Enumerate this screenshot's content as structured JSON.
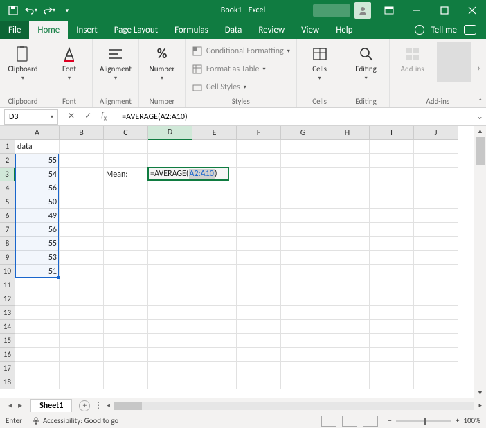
{
  "title": "Book1 - Excel",
  "tabs": {
    "file": "File",
    "home": "Home",
    "insert": "Insert",
    "pageLayout": "Page Layout",
    "formulas": "Formulas",
    "data": "Data",
    "review": "Review",
    "view": "View",
    "help": "Help",
    "tellMe": "Tell me"
  },
  "ribbon": {
    "clipboard": "Clipboard",
    "font": "Font",
    "alignment": "Alignment",
    "number": "Number",
    "styles": "Styles",
    "cells": "Cells",
    "editing": "Editing",
    "addins": "Add-ins",
    "condFmt": "Conditional Formatting",
    "fmtTable": "Format as Table",
    "cellStyles": "Cell Styles"
  },
  "nameBox": "D3",
  "formula": "=AVERAGE(A2:A10)",
  "columns": [
    "A",
    "B",
    "C",
    "D",
    "E",
    "F",
    "G",
    "H",
    "I",
    "J"
  ],
  "activeCol": "D",
  "activeRow": 3,
  "rowCount": 18,
  "cells": {
    "A1": "data",
    "A2": "55",
    "A3": "54",
    "A4": "56",
    "A5": "50",
    "A6": "49",
    "A7": "56",
    "A8": "55",
    "A9": "53",
    "A10": "51",
    "C3": "Mean:"
  },
  "editCell": {
    "pre": "=AVERAGE(",
    "arg": "A2:A10",
    "post": ")"
  },
  "rangeOutline": {
    "col": "A",
    "r1": 2,
    "r2": 10
  },
  "sheet": "Sheet1",
  "status": {
    "mode": "Enter",
    "acc": "Accessibility: Good to go",
    "zoom": "100%"
  }
}
